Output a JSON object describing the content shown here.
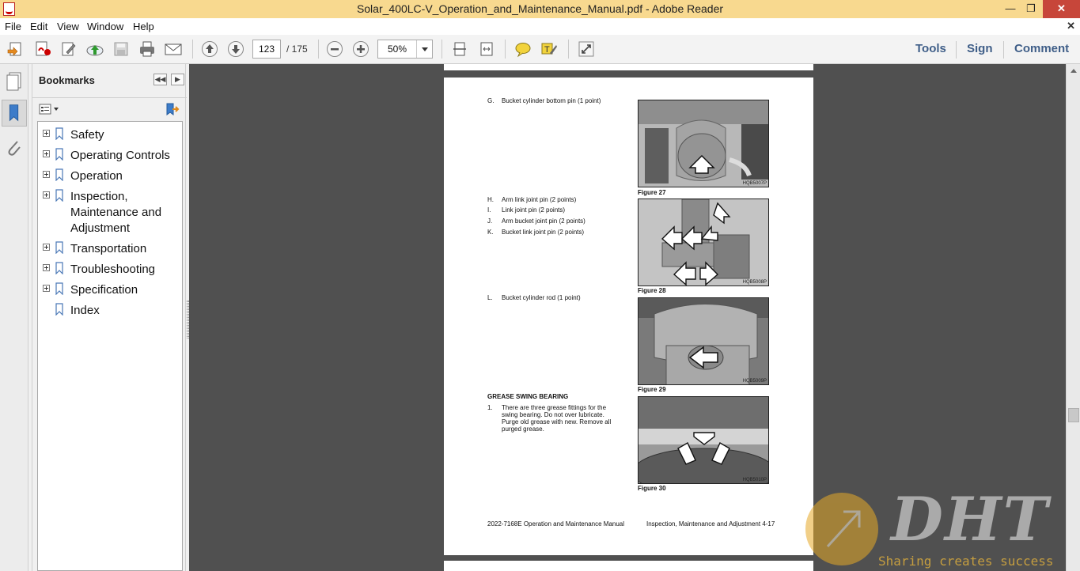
{
  "window": {
    "title": "Solar_400LC-V_Operation_and_Maintenance_Manual.pdf - Adobe Reader"
  },
  "menu": [
    "File",
    "Edit",
    "View",
    "Window",
    "Help"
  ],
  "toolbar": {
    "page_current": "123",
    "page_total": "/ 175",
    "zoom": "50%",
    "tools_label": "Tools",
    "sign_label": "Sign",
    "comment_label": "Comment"
  },
  "bookmarks": {
    "title": "Bookmarks",
    "items": [
      {
        "label": "Safety"
      },
      {
        "label": "Operating Controls"
      },
      {
        "label": "Operation"
      },
      {
        "label": "Inspection, Maintenance and Adjustment"
      },
      {
        "label": "Transportation"
      },
      {
        "label": "Troubleshooting"
      },
      {
        "label": "Specification"
      },
      {
        "label": "Index"
      }
    ]
  },
  "document": {
    "items": [
      {
        "letter": "G.",
        "text": "Bucket cylinder bottom pin (1 point)"
      },
      {
        "letter": "H.",
        "text": "Arm link joint pin (2 points)"
      },
      {
        "letter": "I.",
        "text": "Link joint pin (2 points)"
      },
      {
        "letter": "J.",
        "text": "Arm bucket joint pin (2 points)"
      },
      {
        "letter": "K.",
        "text": "Bucket link joint pin (2 points)"
      },
      {
        "letter": "L.",
        "text": "Bucket cylinder rod (1 point)"
      }
    ],
    "section_heading": "GREASE SWING BEARING",
    "step": {
      "number": "1.",
      "lines": [
        "There are three grease fittings for the",
        "swing bearing. Do not over lubricate.",
        "Purge old grease with new. Remove all",
        "purged grease."
      ]
    },
    "figures": [
      {
        "caption": "Figure 27",
        "id": "HQB5007P"
      },
      {
        "caption": "Figure 28",
        "id": "HQB5008P"
      },
      {
        "caption": "Figure 29",
        "id": "HQB5009P"
      },
      {
        "caption": "Figure 30",
        "id": "HQB5010P"
      }
    ],
    "footer_left": "2022-7168E Operation and Maintenance Manual",
    "footer_right": "Inspection, Maintenance and Adjustment 4-17"
  },
  "watermark": {
    "logo": "DHT",
    "tagline": "Sharing creates success"
  }
}
